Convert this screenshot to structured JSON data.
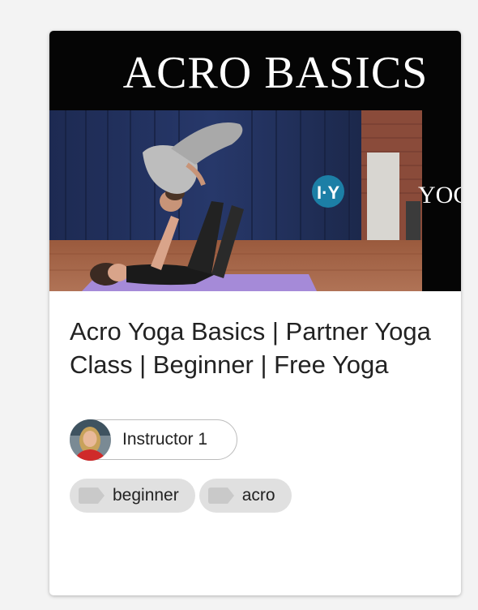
{
  "video": {
    "thumbnail_text": "ACRO BASICS",
    "logo_text": "YOG",
    "title": "Acro Yoga Basics | Partner Yoga Class | Beginner | Free Yoga"
  },
  "instructor": {
    "name": "Instructor 1"
  },
  "tags": [
    {
      "label": "beginner",
      "icon": "tag-icon"
    },
    {
      "label": "acro",
      "icon": "tag-icon"
    }
  ],
  "colors": {
    "page_bg": "#f3f3f3",
    "card_bg": "#ffffff",
    "chip_border": "#bcbcbc",
    "tag_bg": "#e0e0e0",
    "tag_icon": "#c9c9c9",
    "text": "#222222"
  }
}
